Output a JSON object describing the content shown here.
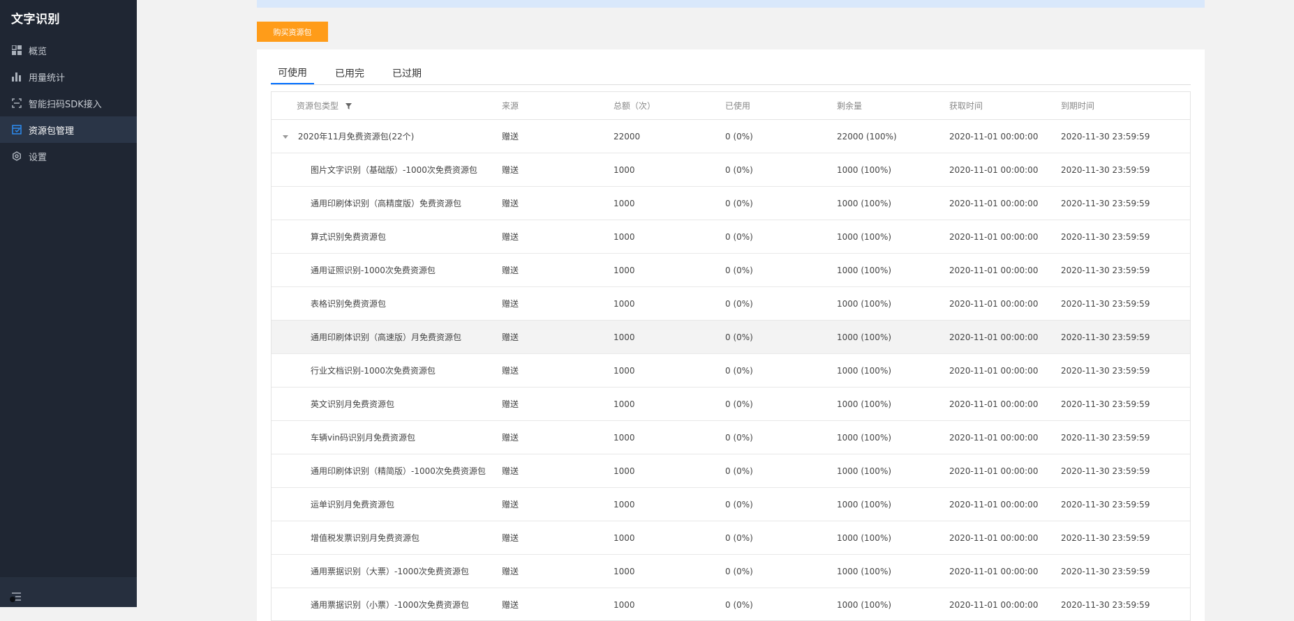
{
  "sidebar": {
    "brand": "文字识别",
    "items": [
      {
        "label": "概览",
        "icon": "dashboard-icon"
      },
      {
        "label": "用量统计",
        "icon": "bar-chart-icon"
      },
      {
        "label": "智能扫码SDK接入",
        "icon": "scan-icon"
      },
      {
        "label": "资源包管理",
        "icon": "package-icon",
        "active": true
      },
      {
        "label": "设置",
        "icon": "gear-icon"
      }
    ],
    "collapse_icon": "menu-collapse-icon"
  },
  "toolbar": {
    "buy_label": "购买资源包"
  },
  "tabs": [
    {
      "label": "可使用",
      "active": true
    },
    {
      "label": "已用完"
    },
    {
      "label": "已过期"
    }
  ],
  "table": {
    "headers": [
      "资源包类型",
      "来源",
      "总额（次）",
      "已使用",
      "剩余量",
      "获取时间",
      "到期时间"
    ],
    "group": {
      "name": "2020年11月免费资源包(22个)",
      "source": "赠送",
      "total": "22000",
      "used": "0 (0%)",
      "remaining": "22000 (100%)",
      "acquired": "2020-11-01 00:00:00",
      "expires": "2020-11-30 23:59:59"
    },
    "rows": [
      {
        "name": "图片文字识别（基础版）-1000次免费资源包",
        "source": "赠送",
        "total": "1000",
        "used": "0 (0%)",
        "remaining": "1000 (100%)",
        "acquired": "2020-11-01 00:00:00",
        "expires": "2020-11-30 23:59:59"
      },
      {
        "name": "通用印刷体识别（高精度版）免费资源包",
        "source": "赠送",
        "total": "1000",
        "used": "0 (0%)",
        "remaining": "1000 (100%)",
        "acquired": "2020-11-01 00:00:00",
        "expires": "2020-11-30 23:59:59"
      },
      {
        "name": "算式识别免费资源包",
        "source": "赠送",
        "total": "1000",
        "used": "0 (0%)",
        "remaining": "1000 (100%)",
        "acquired": "2020-11-01 00:00:00",
        "expires": "2020-11-30 23:59:59"
      },
      {
        "name": "通用证照识别-1000次免费资源包",
        "source": "赠送",
        "total": "1000",
        "used": "0 (0%)",
        "remaining": "1000 (100%)",
        "acquired": "2020-11-01 00:00:00",
        "expires": "2020-11-30 23:59:59"
      },
      {
        "name": "表格识别免费资源包",
        "source": "赠送",
        "total": "1000",
        "used": "0 (0%)",
        "remaining": "1000 (100%)",
        "acquired": "2020-11-01 00:00:00",
        "expires": "2020-11-30 23:59:59"
      },
      {
        "name": "通用印刷体识别（高速版）月免费资源包",
        "source": "赠送",
        "total": "1000",
        "used": "0 (0%)",
        "remaining": "1000 (100%)",
        "acquired": "2020-11-01 00:00:00",
        "expires": "2020-11-30 23:59:59",
        "highlight": true
      },
      {
        "name": "行业文档识别-1000次免费资源包",
        "source": "赠送",
        "total": "1000",
        "used": "0 (0%)",
        "remaining": "1000 (100%)",
        "acquired": "2020-11-01 00:00:00",
        "expires": "2020-11-30 23:59:59"
      },
      {
        "name": "英文识别月免费资源包",
        "source": "赠送",
        "total": "1000",
        "used": "0 (0%)",
        "remaining": "1000 (100%)",
        "acquired": "2020-11-01 00:00:00",
        "expires": "2020-11-30 23:59:59"
      },
      {
        "name": "车辆vin码识别月免费资源包",
        "source": "赠送",
        "total": "1000",
        "used": "0 (0%)",
        "remaining": "1000 (100%)",
        "acquired": "2020-11-01 00:00:00",
        "expires": "2020-11-30 23:59:59"
      },
      {
        "name": "通用印刷体识别（精简版）-1000次免费资源包",
        "source": "赠送",
        "total": "1000",
        "used": "0 (0%)",
        "remaining": "1000 (100%)",
        "acquired": "2020-11-01 00:00:00",
        "expires": "2020-11-30 23:59:59"
      },
      {
        "name": "运单识别月免费资源包",
        "source": "赠送",
        "total": "1000",
        "used": "0 (0%)",
        "remaining": "1000 (100%)",
        "acquired": "2020-11-01 00:00:00",
        "expires": "2020-11-30 23:59:59"
      },
      {
        "name": "增值税发票识别月免费资源包",
        "source": "赠送",
        "total": "1000",
        "used": "0 (0%)",
        "remaining": "1000 (100%)",
        "acquired": "2020-11-01 00:00:00",
        "expires": "2020-11-30 23:59:59"
      },
      {
        "name": "通用票据识别（大票）-1000次免费资源包",
        "source": "赠送",
        "total": "1000",
        "used": "0 (0%)",
        "remaining": "1000 (100%)",
        "acquired": "2020-11-01 00:00:00",
        "expires": "2020-11-30 23:59:59"
      },
      {
        "name": "通用票据识别（小票）-1000次免费资源包",
        "source": "赠送",
        "total": "1000",
        "used": "0 (0%)",
        "remaining": "1000 (100%)",
        "acquired": "2020-11-01 00:00:00",
        "expires": "2020-11-30 23:59:59"
      }
    ]
  },
  "colors": {
    "sidebar_bg": "#1f2633",
    "accent": "#006eff",
    "buy_button": "#ff9c19"
  }
}
